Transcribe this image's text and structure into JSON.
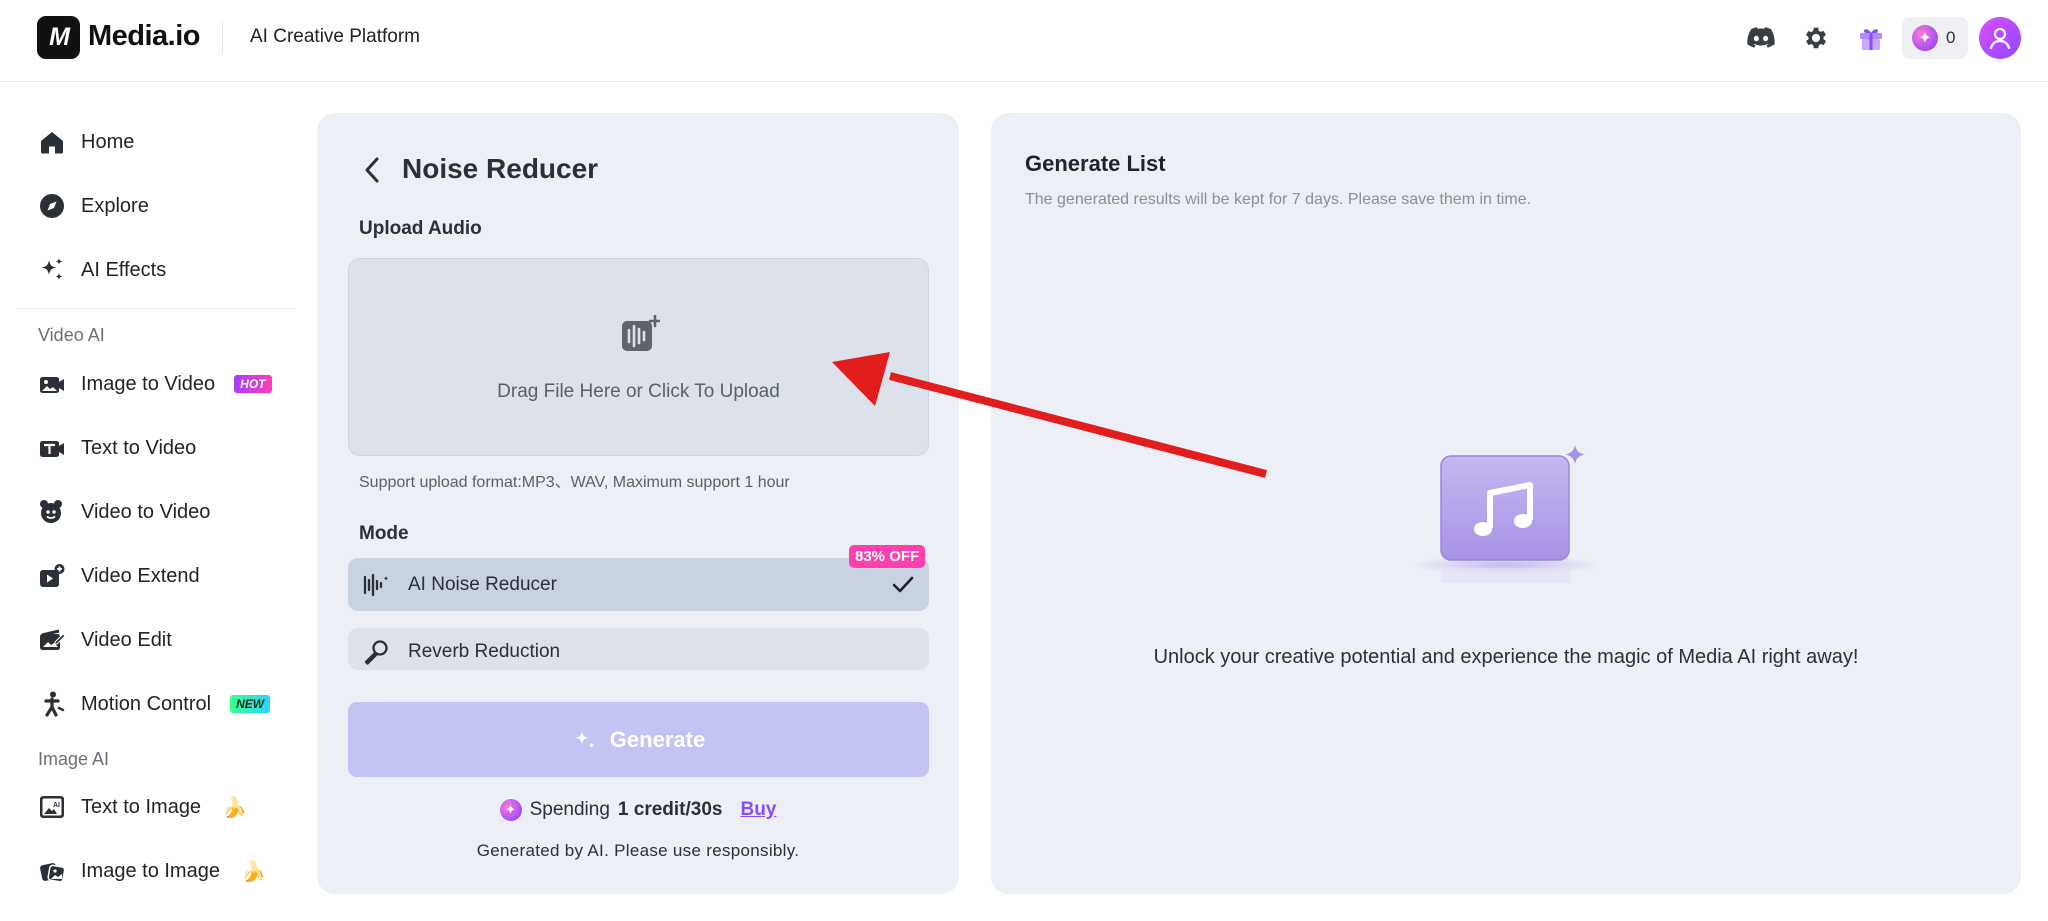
{
  "header": {
    "logo_mark": "M",
    "logo_text": "Media.io",
    "platform_label": "AI Creative Platform",
    "icons": [
      "discord-icon",
      "settings-icon",
      "gift-icon"
    ],
    "credits": "0"
  },
  "sidebar": {
    "top_items": [
      {
        "label": "Home",
        "icon": "home-icon"
      },
      {
        "label": "Explore",
        "icon": "compass-icon"
      },
      {
        "label": "AI Effects",
        "icon": "sparkles-icon"
      }
    ],
    "sections": [
      {
        "title": "Video AI",
        "items": [
          {
            "label": "Image to Video",
            "badge": "HOT"
          },
          {
            "label": "Text to Video"
          },
          {
            "label": "Video to Video"
          },
          {
            "label": "Video Extend"
          },
          {
            "label": "Video Edit"
          },
          {
            "label": "Motion Control",
            "badge": "NEW"
          }
        ]
      },
      {
        "title": "Image AI",
        "items": [
          {
            "label": "Text to Image",
            "emoji": "🍌"
          },
          {
            "label": "Image to Image",
            "emoji": "🍌"
          }
        ]
      }
    ]
  },
  "tool": {
    "title": "Noise Reducer",
    "upload_label": "Upload Audio",
    "upload_prompt": "Drag File Here or Click To Upload",
    "support_note": "Support upload format:MP3、WAV, Maximum support 1 hour",
    "mode_label": "Mode",
    "modes": [
      {
        "label": "AI Noise Reducer",
        "selected": true,
        "discount": "83% OFF"
      },
      {
        "label": "Reverb Reduction",
        "selected": false
      }
    ],
    "generate_label": "Generate",
    "spending_prefix": "Spending",
    "spending_amount": "1 credit/30s",
    "buy_label": "Buy",
    "disclaimer": "Generated by AI. Please use responsibly."
  },
  "generate_list": {
    "title": "Generate List",
    "subtitle": "The generated results will be kept for 7 days. Please save them in time.",
    "empty_message": "Unlock your creative potential and experience the magic of Media AI right away!"
  },
  "colors": {
    "accent": "#8a4bff",
    "generate_disabled": "#c3c3f4",
    "panel_bg": "#eceff5",
    "annotation_red": "#e11d1d",
    "discount_pink": "#ff3fae"
  }
}
